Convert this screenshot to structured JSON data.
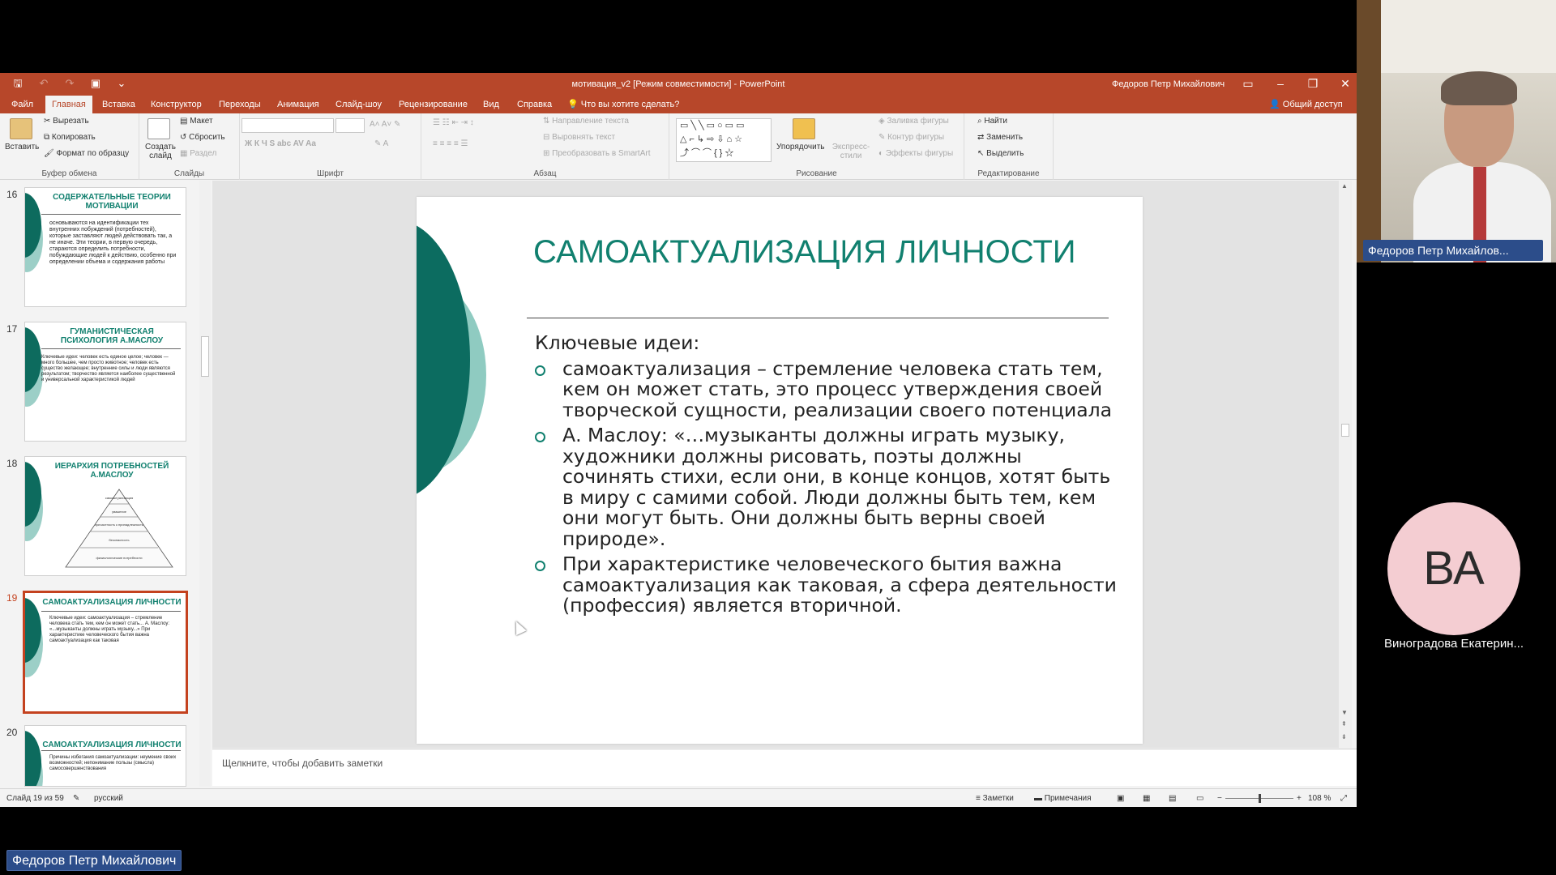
{
  "window": {
    "title": "мотивация_v2 [Режим совместимости] - PowerPoint",
    "user": "Федоров Петр Михайлович"
  },
  "menu": {
    "tabs": [
      "Файл",
      "Главная",
      "Вставка",
      "Конструктор",
      "Переходы",
      "Анимация",
      "Слайд-шоу",
      "Рецензирование",
      "Вид",
      "Справка"
    ],
    "tell_me": "Что вы хотите сделать?",
    "share": "Общий доступ"
  },
  "ribbon": {
    "paste": "Вставить",
    "cut": "Вырезать",
    "copy": "Копировать",
    "format_painter": "Формат по образцу",
    "clipboard_group": "Буфер обмена",
    "new_slide": "Создать слайд",
    "layout": "Макет",
    "reset": "Сбросить",
    "section": "Раздел",
    "slides_group": "Слайды",
    "font_group": "Шрифт",
    "text_direction": "Направление текста",
    "align_text": "Выровнять текст",
    "smartart": "Преобразовать в SmartArt",
    "paragraph_group": "Абзац",
    "arrange": "Упорядочить",
    "quick_styles": "Экспресс-стили",
    "shape_fill": "Заливка фигуры",
    "shape_outline": "Контур фигуры",
    "shape_effects": "Эффекты фигуры",
    "drawing_group": "Рисование",
    "find": "Найти",
    "replace": "Заменить",
    "select": "Выделить",
    "editing_group": "Редактирование"
  },
  "thumbnails": [
    {
      "num": "16",
      "title": "СОДЕРЖАТЕЛЬНЫЕ ТЕОРИИ МОТИВАЦИИ",
      "body": "основываются на идентификации тех внутренних побуждений (потребностей), которые заставляют людей действовать так, а не иначе. Эти теории, в первую очередь, стараются определить потребности, побуждающие людей к действию, особенно при определении объема и содержания работы"
    },
    {
      "num": "17",
      "title": "ГУМАНИСТИЧЕСКАЯ ПСИХОЛОГИЯ А.МАСЛОУ",
      "body": "Ключевые идеи: человек есть единое целое; человек — много большее, чем просто животное; человек есть существо желающее; внутренние силы и люди являются результатом; творчество является наиболее существенной и универсальной характеристикой людей"
    },
    {
      "num": "18",
      "title": "ИЕРАРХИЯ ПОТРЕБНОСТЕЙ А.МАСЛОУ",
      "pyramid": [
        "самоактуализация",
        "уважение",
        "причастность к принадлежности",
        "безопасность",
        "физиологические потребности"
      ]
    },
    {
      "num": "19",
      "title": "САМОАКТУАЛИЗАЦИЯ ЛИЧНОСТИ",
      "body": "Ключевые идеи: самоактуализация – стремление человека стать тем, кем он может стать... А. Маслоу: «...музыканты должны играть музыку...» При характеристике человеческого бытия важна самоактуализация как таковая"
    },
    {
      "num": "20",
      "title": "САМОАКТУАЛИЗАЦИЯ ЛИЧНОСТИ",
      "body": "Причины избегания самоактуализации: неумение своих возможностей; непонимание пользы (смысла) самосовершенствования"
    }
  ],
  "slide": {
    "title": "САМОАКТУАЛИЗАЦИЯ ЛИЧНОСТИ",
    "heading": "Ключевые идеи:",
    "bullets": [
      "самоактуализация – стремление человека стать тем, кем он может стать, это процесс утверждения своей творческой сущности, реализации своего потенциала",
      "А. Маслоу: «…музыканты должны играть музыку, художники должны рисовать, поэты должны сочинять стихи, если они, в конце концов, хотят быть в миру с самими собой. Люди должны быть тем, кем они могут быть. Они должны быть верны своей природе».",
      "При характеристике человеческого бытия важна самоактуализация как таковая, а сфера деятельности (профессия) является вторичной."
    ]
  },
  "notes_placeholder": "Щелкните, чтобы добавить заметки",
  "status": {
    "slide_of": "Слайд 19 из 59",
    "language": "русский",
    "notes": "Заметки",
    "comments": "Примечания",
    "zoom": "108 %",
    "zoom_fraction": 0.5
  },
  "participants": {
    "speaker_cam_label": "Федоров Петр Михайлов...",
    "avatar_initials": "ВА",
    "avatar_name": "Виноградова Екатерин...",
    "active_speaker": "Федоров Петр Михайлович"
  },
  "colors": {
    "ppt_accent": "#b7472a",
    "slide_title": "#11806f",
    "deco_dark": "#0c6c60",
    "deco_light": "#8fcbc1",
    "avatar_bg": "#f4cdd2",
    "label_bg": "#2c4d8a"
  }
}
